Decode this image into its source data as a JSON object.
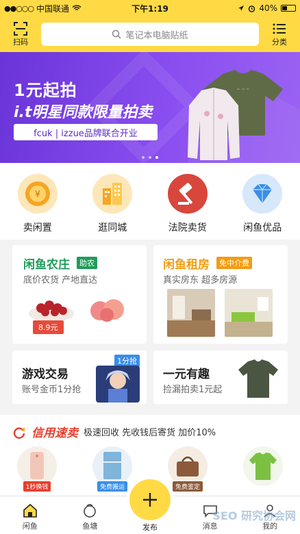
{
  "status_bar": {
    "carrier": "中国联通",
    "time": "下午1:19",
    "battery": "40%"
  },
  "header": {
    "scan_label": "扫码",
    "search_placeholder": "笔记本电脑贴纸",
    "category_label": "分类"
  },
  "banner": {
    "title": "1元起拍",
    "subtitle": "i.t明星同款限量拍卖",
    "tagline": "fcuk | izzue品牌联合开业",
    "pages": 3,
    "active_page": 2
  },
  "quick_links": [
    {
      "label": "卖闲置",
      "icon": "yuan-coin-icon",
      "color": "#f5a623"
    },
    {
      "label": "逛同城",
      "icon": "buildings-icon",
      "color": "#f5a623"
    },
    {
      "label": "法院卖货",
      "icon": "gavel-icon",
      "color": "#d9463b"
    },
    {
      "label": "闲鱼优品",
      "icon": "diamond-icon",
      "color": "#3a8ee6"
    }
  ],
  "cards": {
    "farm": {
      "title": "闲鱼农庄",
      "tag": "助农",
      "desc": "底价农货 产地直达",
      "price": "8.9元"
    },
    "rent": {
      "title": "闲鱼租房",
      "tag": "免中介费",
      "desc": "真实房东 超多房源"
    },
    "game": {
      "title": "游戏交易",
      "tag": "1分抢",
      "desc": "账号金币1分抢"
    },
    "yiyuan": {
      "title": "一元有趣",
      "desc": "捡漏拍卖1元起"
    }
  },
  "credit": {
    "brand": "信用速卖",
    "desc": "极速回收 先收钱后寄货 加价10%",
    "items": [
      {
        "label": "1秒换钱",
        "color": "#e5402f"
      },
      {
        "label": "免费搬运",
        "color": "#3a8ee6"
      },
      {
        "label": "免费鉴定",
        "color": "#8c5a3a"
      },
      {
        "label": "",
        "color": "#7bc043"
      }
    ]
  },
  "tabbar": {
    "home": "闲鱼",
    "pond": "鱼塘",
    "post": "发布",
    "messages": "消息",
    "mine": "我的"
  },
  "watermark": "SEO 研究协会网",
  "colors": {
    "accent": "#ffda44",
    "green": "#1f9c5a",
    "orange": "#f5a623"
  }
}
